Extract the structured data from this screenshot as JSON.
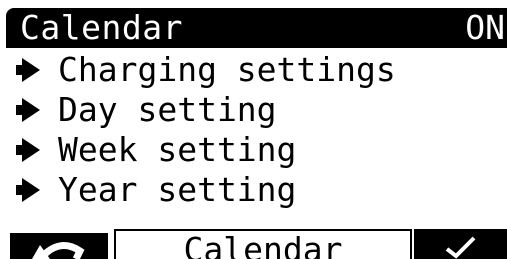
{
  "header": {
    "title": "Calendar",
    "status": "ON"
  },
  "menu": {
    "items": [
      {
        "label": "Charging settings",
        "icon": "right-arrow-icon"
      },
      {
        "label": "Day setting",
        "icon": "right-arrow-icon"
      },
      {
        "label": "Week setting",
        "icon": "right-arrow-icon"
      },
      {
        "label": "Year setting",
        "icon": "right-arrow-icon"
      }
    ]
  },
  "softkeys": {
    "left_icon": "back-arrow-icon",
    "center_label": "Calendar",
    "right_icon": "check-icon"
  },
  "colors": {
    "foreground": "#000000",
    "background": "#ffffff"
  }
}
